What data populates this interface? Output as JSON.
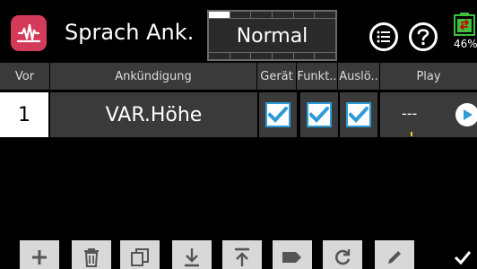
{
  "header": {
    "title": "Sprach Ank.",
    "mode": "Normal",
    "battery_pct": "46%",
    "mode_level_fraction": 0.17
  },
  "table": {
    "columns": [
      "Vor",
      "Ankündigung",
      "Gerät",
      "Funkt..",
      "Auslö..",
      "Play"
    ],
    "rows": [
      {
        "vor": "1",
        "ankuendigung": "VAR.Höhe",
        "geraet": true,
        "funkt": true,
        "ausloe": true,
        "play": "---"
      }
    ]
  },
  "toolbar": {
    "icons": [
      "add-icon",
      "trash-icon",
      "copy-icon",
      "download-icon",
      "upload-icon",
      "tag-icon",
      "refresh-icon",
      "edit-icon",
      "confirm-icon"
    ]
  },
  "colors": {
    "accent": "#2e9bd6",
    "app_icon": "#d43a5a",
    "battery": "#3cc23c",
    "row_bg": "#3a3a3a"
  }
}
